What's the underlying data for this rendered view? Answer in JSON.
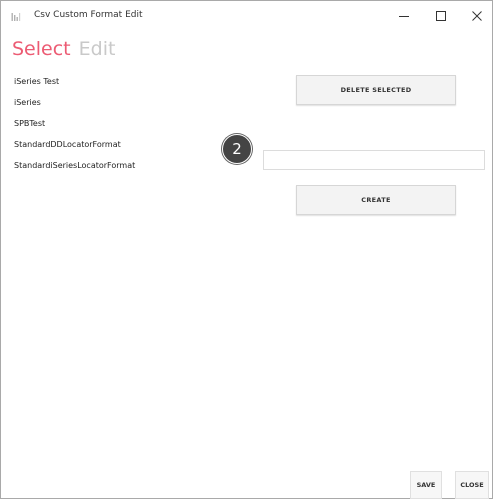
{
  "window": {
    "title": "Csv Custom Format Edit",
    "icon": "app-icon",
    "controls": {
      "minimize": "—",
      "maximize": "☐",
      "close": "✕"
    }
  },
  "tabs": [
    {
      "label": "Select",
      "active": true
    },
    {
      "label": "Edit",
      "active": false
    }
  ],
  "formats": [
    "iSeries Test",
    "iSeries",
    "SPBTest",
    "StandardDDLocatorFormat",
    "StandardiSeriesLocatorFormat"
  ],
  "buttons": {
    "delete_selected": "DELETE SELECTED",
    "create": "CREATE",
    "save": "SAVE",
    "close": "CLOSE"
  },
  "new_format_input": {
    "value": "",
    "placeholder": ""
  },
  "step_badge": "2",
  "colors": {
    "accent": "#ec5b73",
    "inactive_tab": "#c9c9c9",
    "badge_bg": "#444444"
  }
}
